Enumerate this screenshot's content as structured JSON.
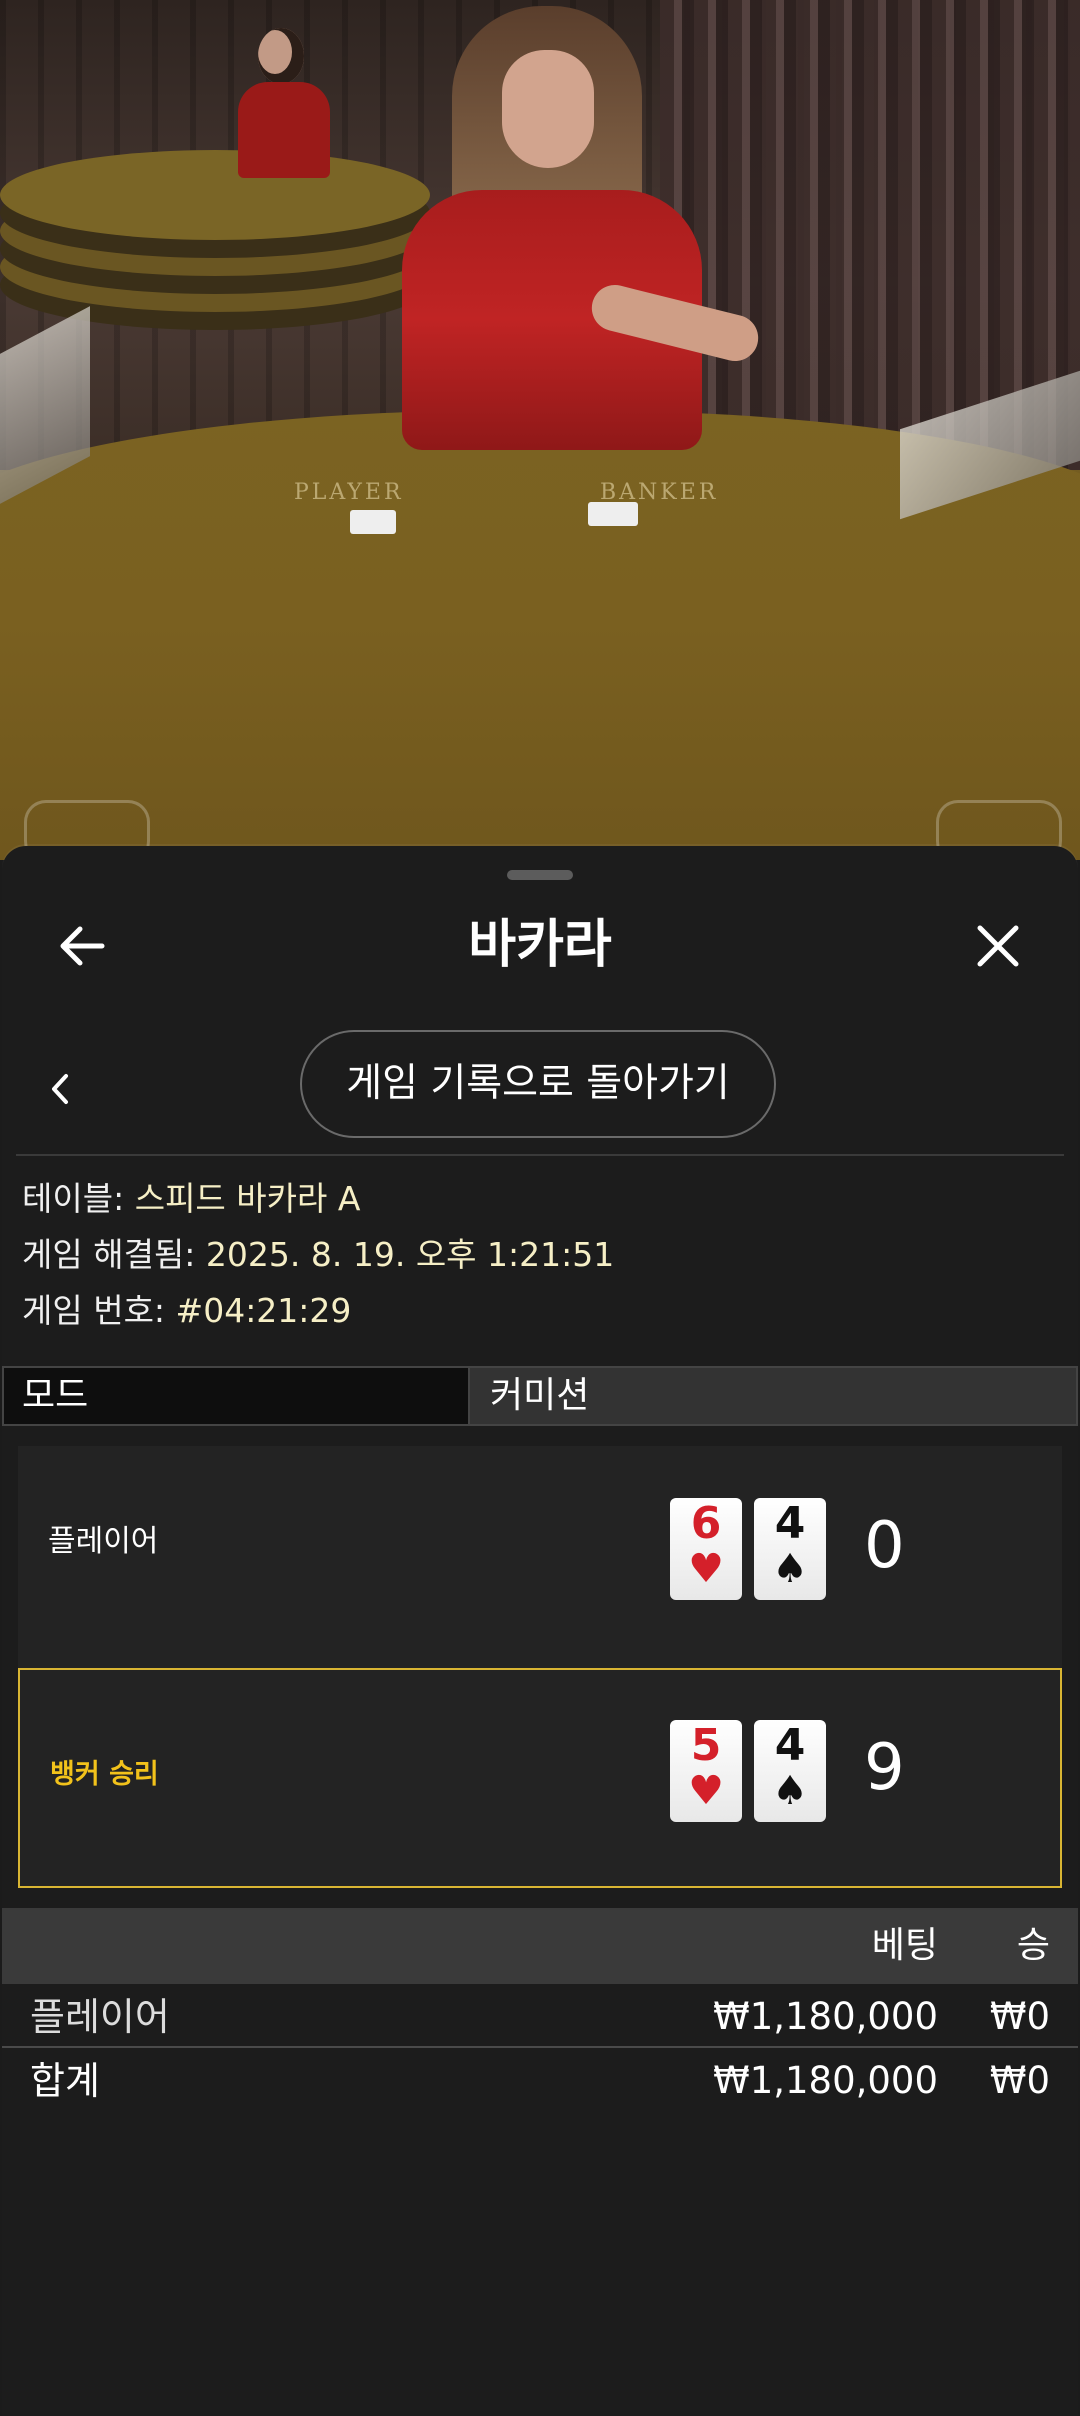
{
  "header": {
    "title": "바카라"
  },
  "history_button": {
    "label": "게임 기록으로 돌아가기"
  },
  "info": {
    "table_label": "테이블: ",
    "table_value": "스피드 바카라 A",
    "resolved_label": "게임 해결됨: ",
    "resolved_value": "2025. 8. 19. 오후 1:21:51",
    "number_label": "게임 번호: ",
    "number_value": "#04:21:29"
  },
  "mode": {
    "left_label": "모드",
    "right_label": "커미션"
  },
  "hands": [
    {
      "label": "플레이어",
      "winner": false,
      "score": "0",
      "cards": [
        {
          "rank": "6",
          "suit": "♥",
          "color": "red"
        },
        {
          "rank": "4",
          "suit": "♠",
          "color": "black"
        }
      ]
    },
    {
      "label": "뱅커 승리",
      "winner": true,
      "score": "9",
      "cards": [
        {
          "rank": "5",
          "suit": "♥",
          "color": "red"
        },
        {
          "rank": "4",
          "suit": "♠",
          "color": "black"
        }
      ]
    }
  ],
  "table": {
    "headers": {
      "bet": "베팅",
      "win": "승"
    },
    "rows": [
      {
        "label": "플레이어",
        "bet": "₩1,180,000",
        "win": "₩0"
      }
    ],
    "total": {
      "label": "합계",
      "bet": "₩1,180,000",
      "win": "₩0"
    }
  },
  "scene": {
    "felt_player": "PLAYER",
    "felt_banker": "BANKER"
  },
  "colors": {
    "accent_win": "#f2c21b",
    "info_value": "#f6efc6",
    "sheet_bg": "#1c1c1c"
  },
  "icons": {
    "back": "arrow-left-icon",
    "close": "close-icon",
    "prev": "chevron-left-icon"
  }
}
